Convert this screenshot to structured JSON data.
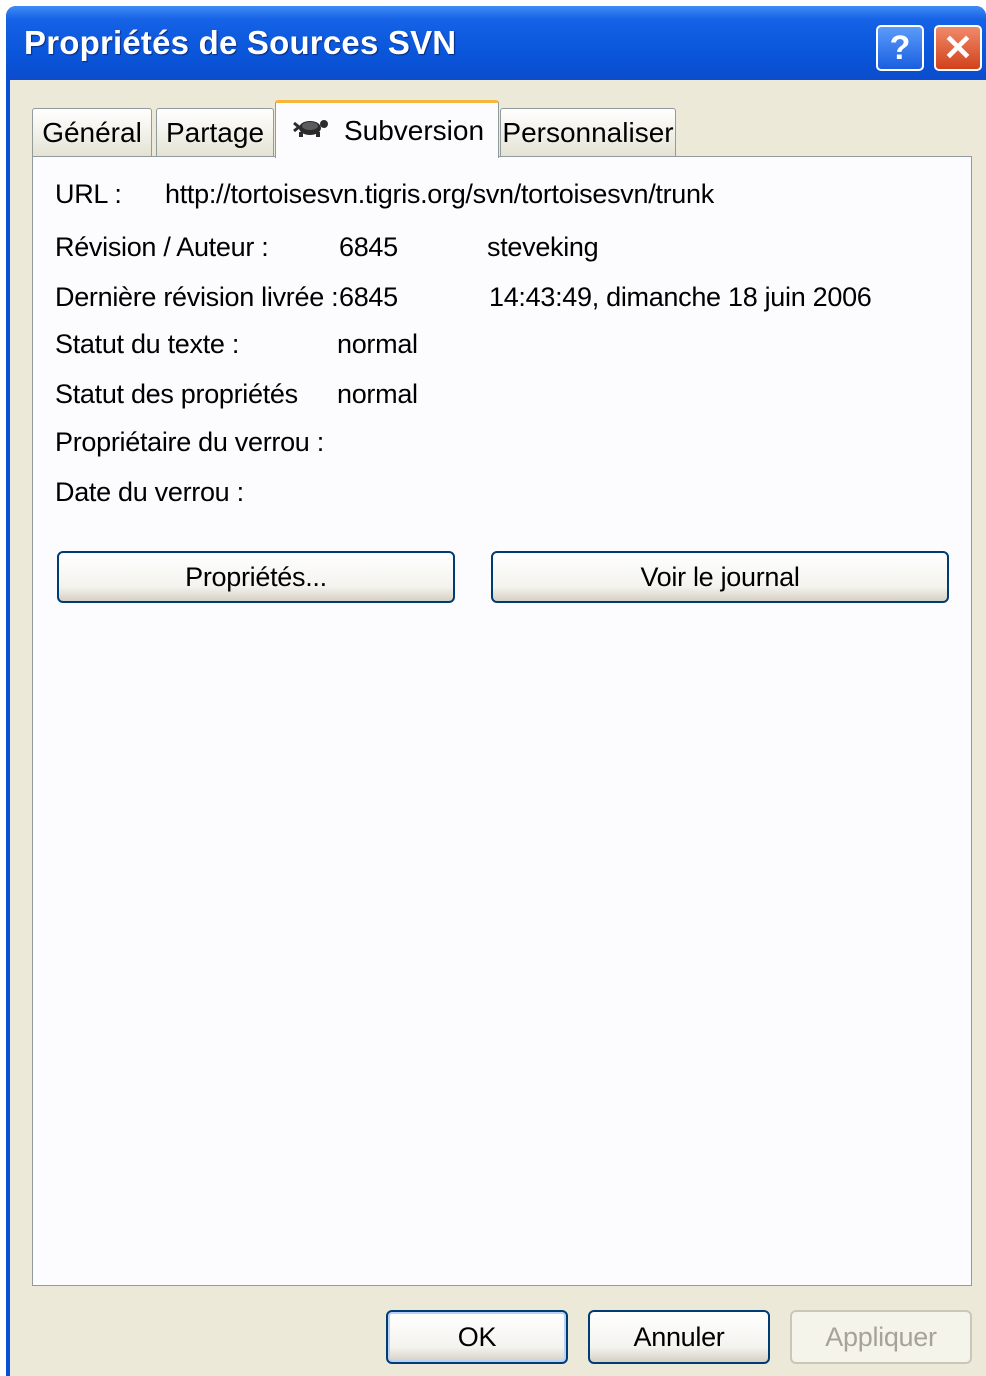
{
  "window": {
    "title": "Propriétés de Sources SVN",
    "help_label": "?",
    "close_label": "✕"
  },
  "tabs": [
    {
      "label": "Général"
    },
    {
      "label": "Partage"
    },
    {
      "label": "Subversion",
      "icon": "tortoise-icon",
      "active": true
    },
    {
      "label": "Personnaliser"
    }
  ],
  "info": {
    "url_label": "URL :",
    "url_value": "http://tortoisesvn.tigris.org/svn/tortoisesvn/trunk",
    "revision_label": "Révision / Auteur :",
    "revision_value": "6845",
    "author_value": "steveking",
    "last_commit_label": "Dernière révision livrée :",
    "last_commit_value": "6845",
    "last_commit_date": "14:43:49, dimanche 18 juin 2006",
    "text_status_label": "Statut du texte :",
    "text_status_value": "normal",
    "prop_status_label": "Statut des propriétés",
    "prop_status_value": "normal",
    "lock_owner_label": "Propriétaire du verrou :",
    "lock_date_label": "Date du verrou :"
  },
  "panel_buttons": {
    "properties": "Propriétés...",
    "show_log": "Voir le journal"
  },
  "dialog_buttons": {
    "ok": "OK",
    "cancel": "Annuler",
    "apply": "Appliquer"
  }
}
